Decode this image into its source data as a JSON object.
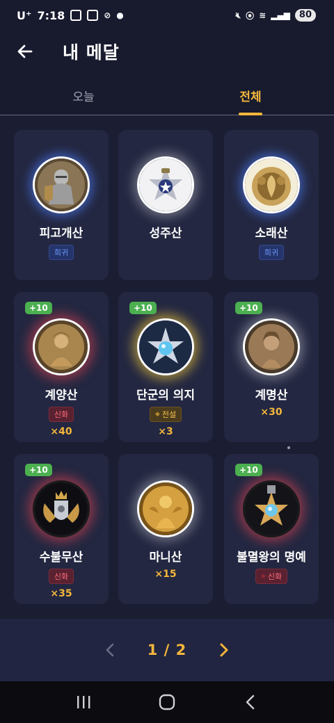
{
  "status_bar": {
    "carrier": "U⁺",
    "time": "7:18",
    "battery": "80"
  },
  "header": {
    "title": "내 메달"
  },
  "tabs": [
    {
      "label": "오늘",
      "active": false
    },
    {
      "label": "전체",
      "active": true
    }
  ],
  "medals": [
    {
      "name": "피고개산",
      "rarity": "희귀",
      "count": "",
      "bonus": "",
      "icon": "knight-medal-icon"
    },
    {
      "name": "성주산",
      "rarity": "",
      "count": "",
      "bonus": "",
      "icon": "star-crest-medal-icon"
    },
    {
      "name": "소래산",
      "rarity": "희귀",
      "count": "",
      "bonus": "",
      "icon": "gold-crest-medal-icon"
    },
    {
      "name": "계양산",
      "rarity": "신화",
      "count": "×40",
      "bonus": "+10",
      "icon": "goddess-medal-icon"
    },
    {
      "name": "단군의 의지",
      "rarity": "전설",
      "count": "×3",
      "bonus": "+10",
      "icon": "crystal-star-medal-icon"
    },
    {
      "name": "계명산",
      "rarity": "",
      "count": "×30",
      "bonus": "+10",
      "icon": "bronze-portrait-medal-icon"
    },
    {
      "name": "수불무산",
      "rarity": "신화",
      "count": "×35",
      "bonus": "+10",
      "icon": "shield-crest-medal-icon"
    },
    {
      "name": "마니산",
      "rarity": "",
      "count": "×15",
      "bonus": "",
      "icon": "golden-goddess-medal-icon"
    },
    {
      "name": "불멸왕의 명예",
      "rarity": "신화",
      "count": "",
      "bonus": "+10",
      "icon": "honor-star-medal-icon"
    }
  ],
  "pagination": {
    "current": "1 / 2"
  },
  "colors": {
    "accent": "#f4b73b",
    "background": "#181b2e",
    "card": "#232741",
    "bonus_badge": "#4caf50",
    "rare": "#6c9bff",
    "myth": "#ff6c7a",
    "legend": "#f4c04a"
  }
}
